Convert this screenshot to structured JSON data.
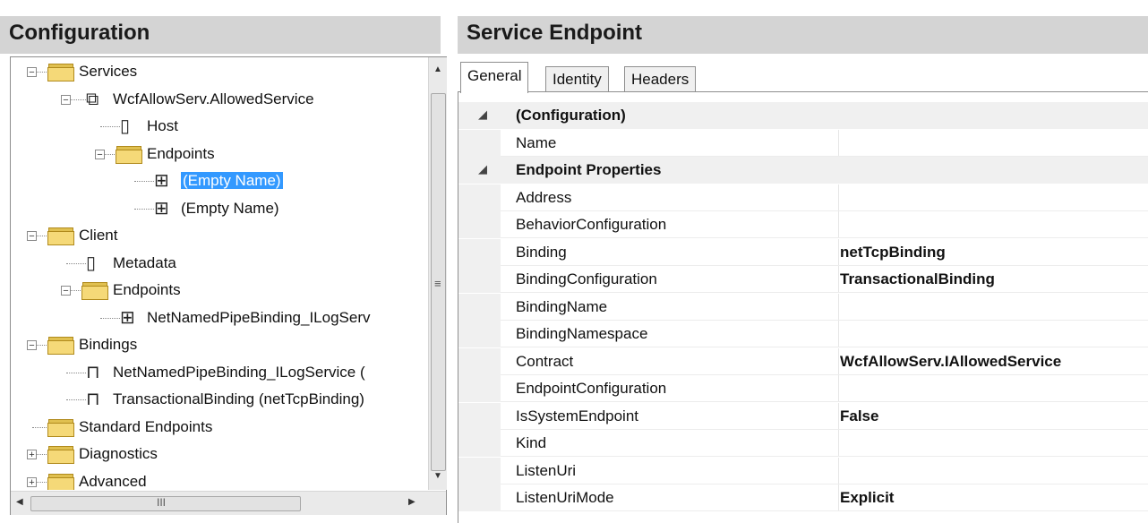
{
  "left": {
    "title": "Configuration",
    "tree": [
      {
        "label": "Services",
        "level": 0,
        "type": "folder",
        "expander": "−"
      },
      {
        "label": "WcfAllowServ.AllowedService",
        "level": 1,
        "type": "service",
        "expander": "−"
      },
      {
        "label": "Host",
        "level": 2,
        "type": "doc"
      },
      {
        "label": "Endpoints",
        "level": 2,
        "type": "folder",
        "expander": "−"
      },
      {
        "label": "(Empty Name)",
        "level": 3,
        "type": "endpoint",
        "selected": true
      },
      {
        "label": "(Empty Name)",
        "level": 3,
        "type": "endpoint"
      },
      {
        "label": "Client",
        "level": 0,
        "type": "folder",
        "expander": "−"
      },
      {
        "label": "Metadata",
        "level": 1,
        "type": "doc"
      },
      {
        "label": "Endpoints",
        "level": 1,
        "type": "folder",
        "expander": "−"
      },
      {
        "label": "NetNamedPipeBinding_ILogServ",
        "level": 2,
        "type": "endpoint"
      },
      {
        "label": "Bindings",
        "level": 0,
        "type": "folder",
        "expander": "−"
      },
      {
        "label": "NetNamedPipeBinding_ILogService (",
        "level": 1,
        "type": "binding"
      },
      {
        "label": "TransactionalBinding (netTcpBinding)",
        "level": 1,
        "type": "binding"
      },
      {
        "label": "Standard Endpoints",
        "level": 0,
        "type": "folder"
      },
      {
        "label": "Diagnostics",
        "level": 0,
        "type": "folder",
        "expander": "+"
      },
      {
        "label": "Advanced",
        "level": 0,
        "type": "folder",
        "expander": "+"
      }
    ],
    "scroll_grip": "≡",
    "hscroll_grip": "III"
  },
  "right": {
    "title": "Service Endpoint",
    "tabs": [
      "General",
      "Identity",
      "Headers"
    ],
    "active_tab": 0,
    "rows": [
      {
        "name": "(Configuration)",
        "value": "",
        "category": true
      },
      {
        "name": "Name",
        "value": ""
      },
      {
        "name": "Endpoint Properties",
        "value": "",
        "category": true
      },
      {
        "name": "Address",
        "value": ""
      },
      {
        "name": "BehaviorConfiguration",
        "value": ""
      },
      {
        "name": "Binding",
        "value": "netTcpBinding"
      },
      {
        "name": "BindingConfiguration",
        "value": "TransactionalBinding"
      },
      {
        "name": "BindingName",
        "value": ""
      },
      {
        "name": "BindingNamespace",
        "value": ""
      },
      {
        "name": "Contract",
        "value": "WcfAllowServ.IAllowedService"
      },
      {
        "name": "EndpointConfiguration",
        "value": ""
      },
      {
        "name": "IsSystemEndpoint",
        "value": "False"
      },
      {
        "name": "Kind",
        "value": ""
      },
      {
        "name": "ListenUri",
        "value": ""
      },
      {
        "name": "ListenUriMode",
        "value": "Explicit"
      }
    ]
  },
  "colors": {
    "selection": "#3399ff",
    "header_bg": "#d4d4d4",
    "folder": "#f5d978"
  }
}
